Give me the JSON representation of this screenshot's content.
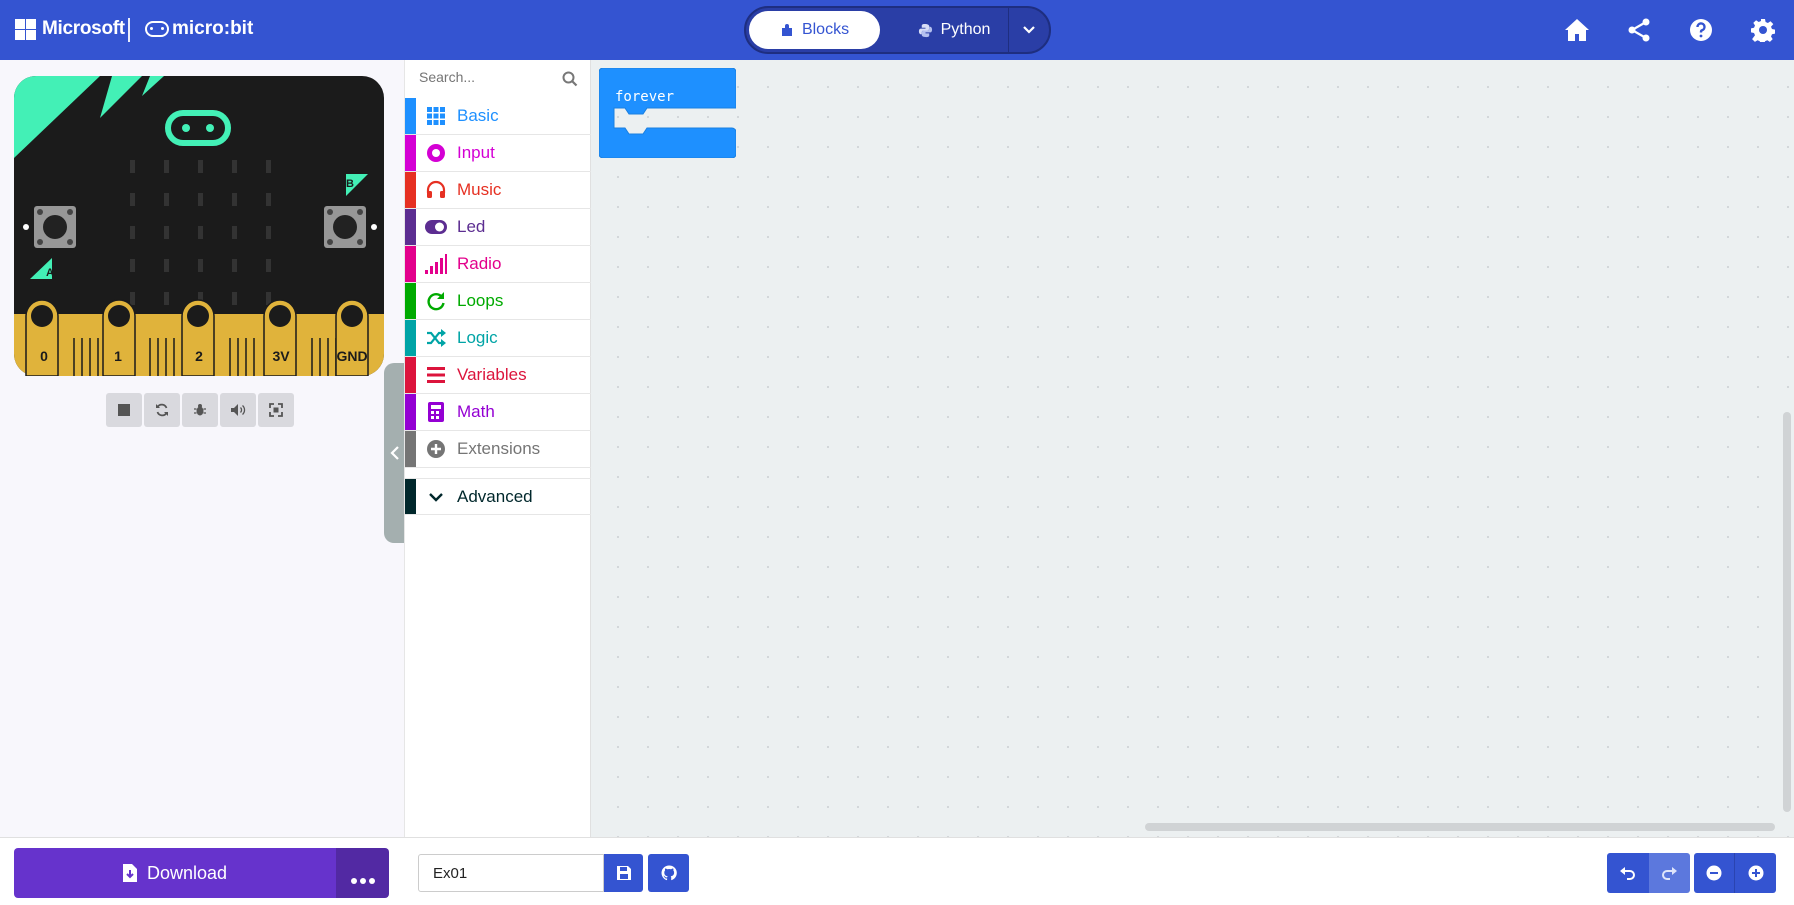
{
  "header": {
    "microsoft_label": "Microsoft",
    "microbit_label": "micro:bit",
    "mode_blocks_label": "Blocks",
    "mode_python_label": "Python"
  },
  "simulator": {
    "pin_labels": [
      "0",
      "1",
      "2",
      "3V",
      "GND"
    ],
    "button_a_label": "A",
    "button_b_label": "B"
  },
  "toolbox": {
    "search_placeholder": "Search...",
    "categories": [
      {
        "label": "Basic",
        "color": "#1e90ff",
        "icon": "grid-icon"
      },
      {
        "label": "Input",
        "color": "#d400d4",
        "icon": "target-icon"
      },
      {
        "label": "Music",
        "color": "#e63022",
        "icon": "headphones-icon"
      },
      {
        "label": "Led",
        "color": "#5c2d91",
        "icon": "toggle-icon"
      },
      {
        "label": "Radio",
        "color": "#e3008c",
        "icon": "signal-bars-icon"
      },
      {
        "label": "Loops",
        "color": "#00aa00",
        "icon": "refresh-icon"
      },
      {
        "label": "Logic",
        "color": "#00a4a6",
        "icon": "shuffle-icon"
      },
      {
        "label": "Variables",
        "color": "#dc143c",
        "icon": "list-icon"
      },
      {
        "label": "Math",
        "color": "#9400d3",
        "icon": "calculator-icon"
      },
      {
        "label": "Extensions",
        "color": "#757575",
        "icon": "plus-circle-icon"
      },
      {
        "label": "Advanced",
        "color": "#00272b",
        "icon": "chevron-down-icon"
      }
    ]
  },
  "workspace": {
    "block_label": "forever",
    "block_color": "#1e90ff"
  },
  "footer": {
    "download_label": "Download",
    "project_name": "Ex01"
  },
  "colors": {
    "header_bg": "#3454d1",
    "download_bg": "#6633cc",
    "board_bg": "#1b1b1b",
    "board_accent": "#43f0b6",
    "board_pins": "#e0b33b"
  }
}
